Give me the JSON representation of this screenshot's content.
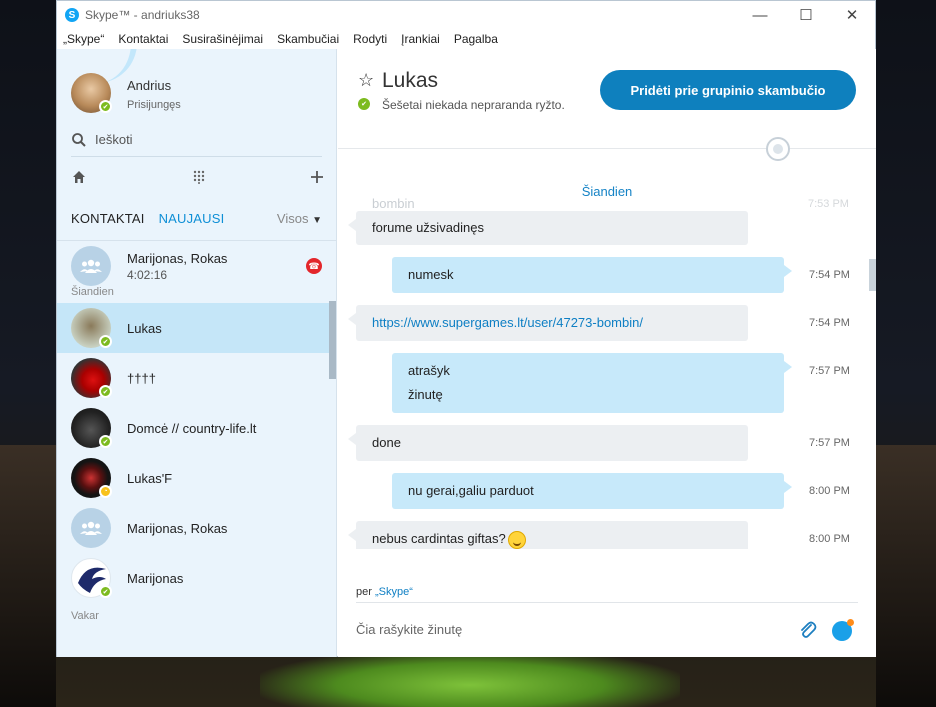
{
  "window": {
    "title": "Skype™ - andriuks38",
    "min": "—",
    "max": "☐",
    "close": "✕"
  },
  "menu": [
    "„Skype“",
    "Kontaktai",
    "Susirašinėjimai",
    "Skambučiai",
    "Rodyti",
    "Įrankiai",
    "Pagalba"
  ],
  "profile": {
    "name": "Andrius",
    "status": "Prisijungęs"
  },
  "search": {
    "placeholder": "Ieškoti"
  },
  "tabs": {
    "contacts": "KONTAKTAI",
    "recent": "NAUJAUSI",
    "all": "Visos"
  },
  "recent": [
    {
      "name": "Marijonas, Rokas",
      "sub": "4:02:16",
      "type": "group"
    },
    {
      "section": "Šiandien"
    },
    {
      "name": "Lukas",
      "selected": true,
      "presence": "online"
    },
    {
      "name": "††††",
      "presence": "online"
    },
    {
      "name": "Domcė // country-life.lt",
      "presence": "online"
    },
    {
      "name": "Lukas'F",
      "presence": "away"
    },
    {
      "name": "Marijonas, Rokas",
      "type": "group"
    },
    {
      "name": "Marijonas",
      "presence": "online"
    },
    {
      "section": "Vakar"
    }
  ],
  "chat": {
    "contact": "Lukas",
    "mood": "Šešetai niekada nepraranda ryžto.",
    "group_call_label": "Pridėti prie grupinio skambučio",
    "today_label": "Šiandien",
    "ghost_msg": "bombin",
    "ghost_time": "7:53 PM",
    "messages": [
      {
        "dir": "in",
        "lines": [
          "forume užsivadinęs"
        ],
        "time": ""
      },
      {
        "dir": "out",
        "lines": [
          "numesk"
        ],
        "time": "7:54 PM"
      },
      {
        "dir": "in",
        "lines": [
          "https://www.supergames.lt/user/47273-bombin/"
        ],
        "time": "7:54 PM",
        "link": true
      },
      {
        "dir": "out",
        "lines": [
          "atrašyk",
          "žinutę"
        ],
        "time": "7:57 PM"
      },
      {
        "dir": "in",
        "lines": [
          "done"
        ],
        "time": "7:57 PM"
      },
      {
        "dir": "out",
        "lines": [
          "nu gerai,galiu parduot"
        ],
        "time": "8:00 PM"
      },
      {
        "dir": "in",
        "lines": [
          "nebus cardintas giftas?"
        ],
        "time": "8:00 PM",
        "emoji": "smile"
      }
    ],
    "via_prefix": "per",
    "via_link": "„Skype“",
    "compose_placeholder": "Čia rašykite žinutę"
  },
  "colors": {
    "accent": "#0e80be",
    "online": "#7dbb1f",
    "away": "#f8c21c",
    "end_call": "#e3262b"
  }
}
